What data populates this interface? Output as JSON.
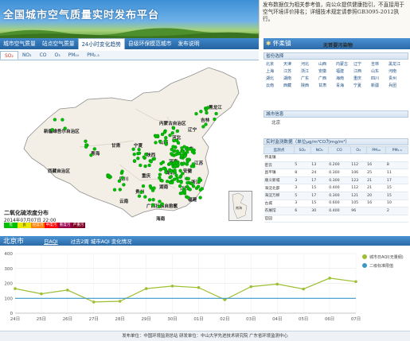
{
  "banner": {
    "title": "全国城市空气质量实时发布平台",
    "notice": "发布数据仅为相关参考值，向公众提供健康指引，不直接用于空气环境评价排名；详细技术规定请参照GB3095-2012执行。"
  },
  "nav": {
    "tabs": [
      "城市空气质量",
      "站点空气质量",
      "24小时变化趋势",
      "县级环保模范城市",
      "发布说明"
    ],
    "active": 2
  },
  "pollutant_tabs": [
    "SO₂",
    "NO₂",
    "CO",
    "O₃",
    "PM₁₀",
    "PM₂.₅"
  ],
  "map": {
    "provinces": [
      "黑龙江",
      "吉林",
      "辽宁",
      "内蒙古自治区",
      "新疆维吾尔自治区",
      "西藏自治区",
      "青海",
      "甘肃",
      "宁夏",
      "陕西",
      "山西",
      "河北",
      "山东",
      "河南",
      "四川",
      "重庆",
      "湖北",
      "安徽",
      "江苏",
      "浙江",
      "江西",
      "湖南",
      "贵州",
      "云南",
      "广西壮族自治区",
      "广东",
      "福建",
      "海南"
    ],
    "legend_title": "二氧化硫浓度分布",
    "legend_time": "2014年07月07日 22:00",
    "legend": [
      {
        "label": "优",
        "color": "#00c000"
      },
      {
        "label": "良",
        "color": "#e8e800"
      },
      {
        "label": "轻度污染",
        "color": "#ff7e00"
      },
      {
        "label": "中度污染",
        "color": "#ff0000"
      },
      {
        "label": "重度污染",
        "color": "#99004c"
      },
      {
        "label": "严重污染",
        "color": "#7e0023"
      }
    ],
    "inset_label": "南海"
  },
  "city_panel": {
    "header": "怀柔镇",
    "status": "无首要污染物",
    "province_title": "省份选择",
    "provinces": [
      "北京",
      "天津",
      "河北",
      "山西",
      "内蒙古",
      "辽宁",
      "吉林",
      "黑龙江",
      "上海",
      "江苏",
      "浙江",
      "安徽",
      "福建",
      "江西",
      "山东",
      "河南",
      "湖北",
      "湖南",
      "广东",
      "广西",
      "海南",
      "重庆",
      "四川",
      "贵州",
      "云南",
      "西藏",
      "陕西",
      "甘肃",
      "青海",
      "宁夏",
      "新疆",
      "兵团"
    ],
    "city_info_title": "城市信息",
    "city_info_value": "北京",
    "monitor_title": "实时监测数据（单位μg/m³CO为mg/m³）",
    "columns": [
      "监测点",
      "SO₂",
      "NO₂",
      "CO",
      "O₃",
      "PM₁₀",
      "PM₂.₅"
    ],
    "rows": [
      [
        "怀柔镇",
        "",
        "",
        "",
        "",
        "",
        ""
      ],
      [
        "密云",
        "5",
        "13",
        "0.200",
        "112",
        "16",
        "8"
      ],
      [
        "昌平镇",
        "8",
        "24",
        "0.300",
        "106",
        "25",
        "11"
      ],
      [
        "顺义新城",
        "3",
        "17",
        "0.300",
        "123",
        "21",
        "17"
      ],
      [
        "海淀北部",
        "3",
        "15",
        "0.400",
        "112",
        "21",
        "15"
      ],
      [
        "海淀万柳",
        "5",
        "17",
        "0.300",
        "121",
        "20",
        "15"
      ],
      [
        "古城",
        "3",
        "15",
        "0.600",
        "105",
        "16",
        "10"
      ],
      [
        "农展馆",
        "6",
        "30",
        "0.400",
        "96",
        "",
        "2"
      ],
      [
        "官园",
        "",
        "",
        "",
        "",
        "",
        ""
      ]
    ]
  },
  "chart_bar": {
    "city": "北京市",
    "tabs": [
      "日AQI",
      "过去2周 城市AQI 变化情况"
    ]
  },
  "chart_data": {
    "type": "line",
    "x": [
      "24日",
      "25日",
      "26日",
      "27日",
      "28日",
      "29日",
      "30日",
      "01日",
      "02日",
      "03日",
      "04日",
      "05日",
      "06日",
      "07日"
    ],
    "series": [
      {
        "name": "城市日AQI(无量纲)",
        "color": "#9dbf33",
        "values": [
          165,
          130,
          155,
          75,
          80,
          165,
          182,
          172,
          90,
          178,
          195,
          162,
          235,
          212
        ]
      },
      {
        "name": "二级标准限值",
        "color": "#3a97c9",
        "values": [
          100,
          100,
          100,
          100,
          100,
          100,
          100,
          100,
          100,
          100,
          100,
          100,
          100,
          100
        ]
      }
    ],
    "ylim": [
      0,
      400
    ],
    "yticks": [
      0,
      100,
      200,
      300,
      400
    ],
    "legend_position": "top-right",
    "grid": true
  },
  "footer": "发布单位：中国环境监测总站    研发单位：中山大学先进技术研究院 广东省环境监测中心"
}
